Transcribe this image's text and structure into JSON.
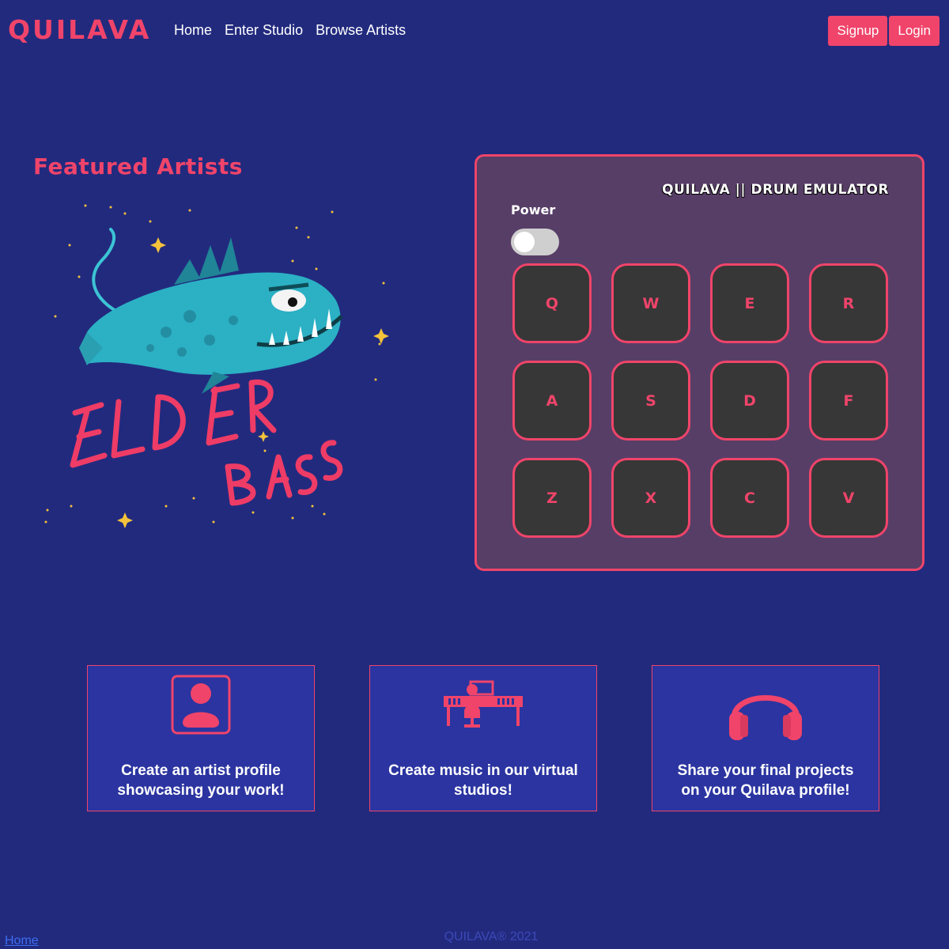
{
  "brand": {
    "name": "QUILAVA"
  },
  "nav": {
    "links": [
      "Home",
      "Enter Studio",
      "Browse Artists"
    ]
  },
  "auth": {
    "signup": "Signup",
    "login": "Login"
  },
  "featured": {
    "title": "Featured Artists",
    "art": {
      "text_line1": "ELDER",
      "text_line2": "BASS",
      "icon": "angler-fish-illustration"
    }
  },
  "drum": {
    "title": "QUILAVA || DRUM EMULATOR",
    "power_label": "Power",
    "power_on": false,
    "pads": [
      "Q",
      "W",
      "E",
      "R",
      "A",
      "S",
      "D",
      "F",
      "Z",
      "X",
      "C",
      "V"
    ]
  },
  "cards": [
    {
      "icon": "user-profile-icon",
      "text": "Create an artist profile showcasing your work!"
    },
    {
      "icon": "music-studio-icon",
      "text": "Create music in our virtual studios!"
    },
    {
      "icon": "headphones-icon",
      "text": "Share your final projects on your Quilava profile!"
    }
  ],
  "footer": {
    "link": "Home",
    "copyright": "QUILAVA® 2021"
  },
  "colors": {
    "background": "#222a7e",
    "accent": "#f0446a",
    "drum_panel": "#573e67",
    "pad": "#373737",
    "card": "#2b34a0"
  }
}
